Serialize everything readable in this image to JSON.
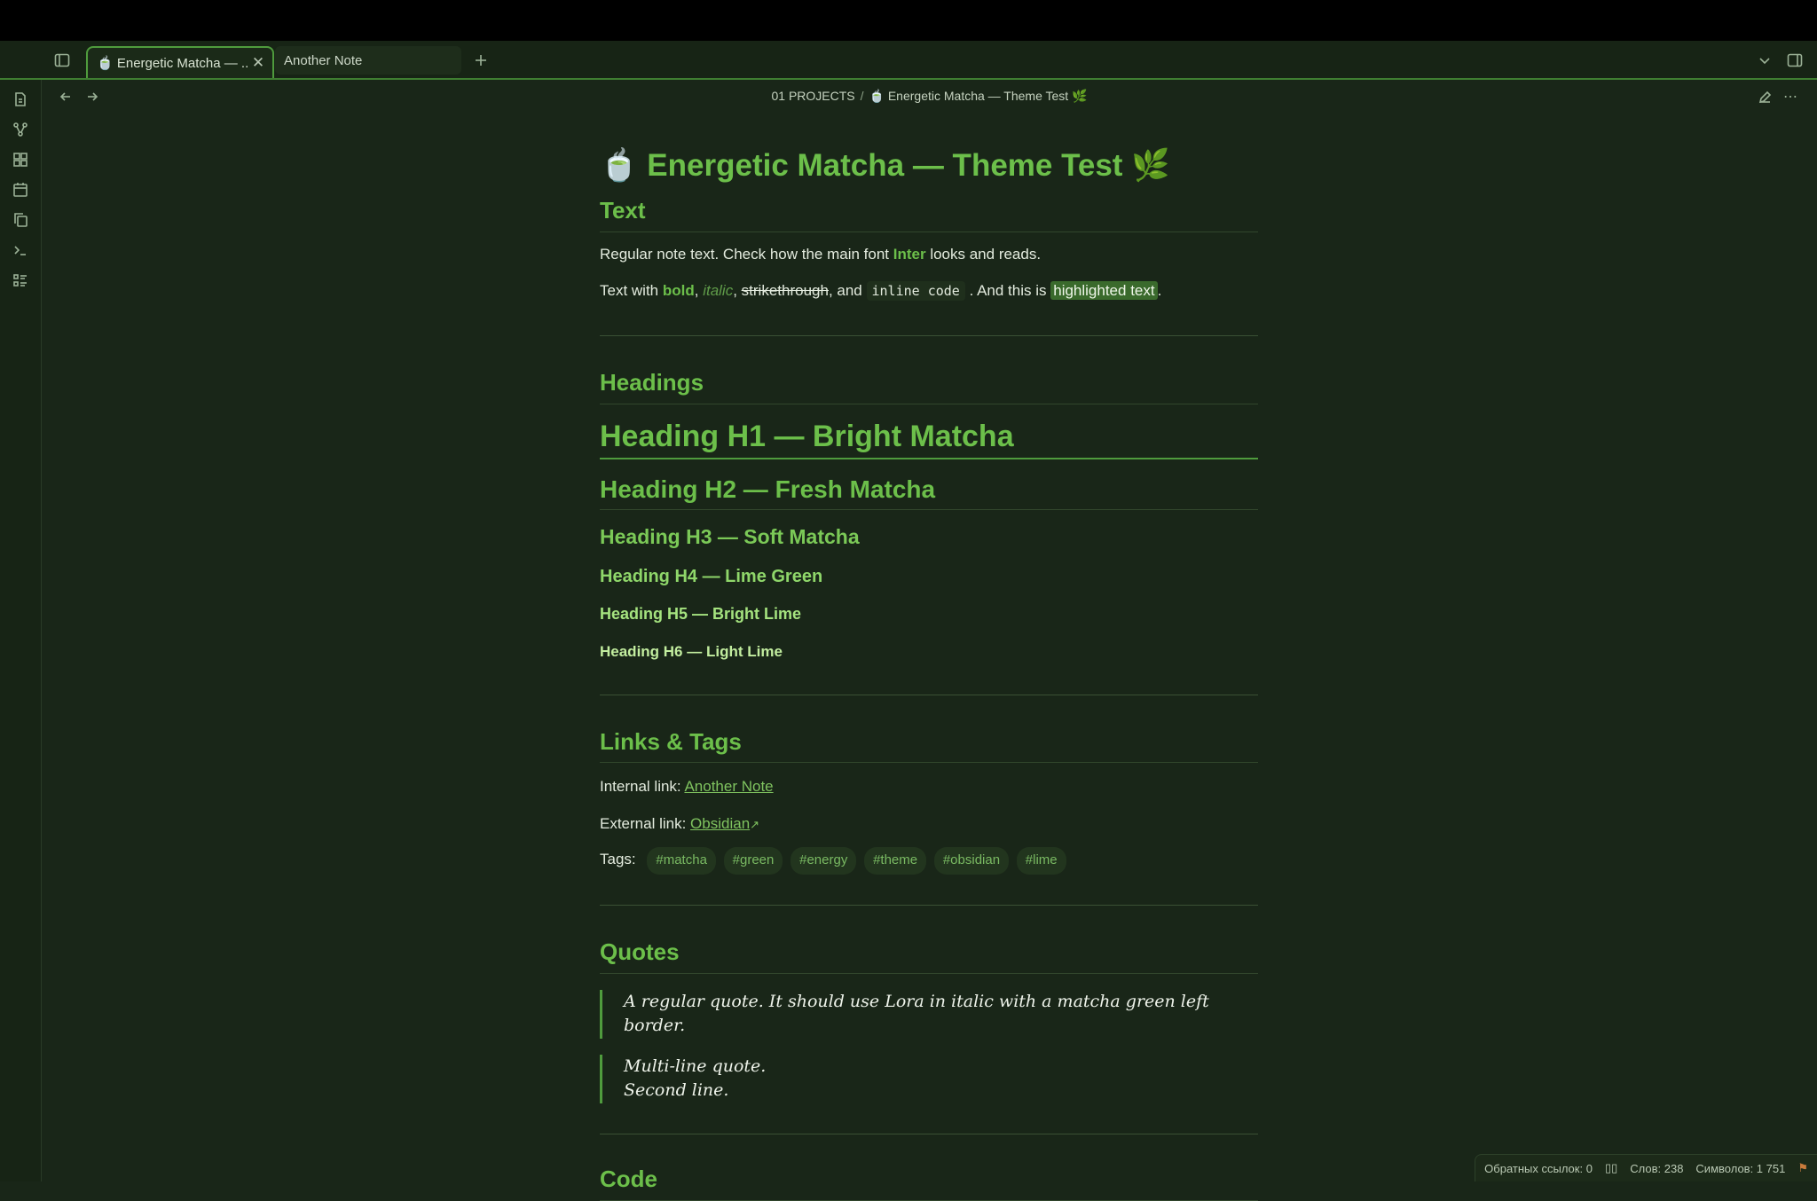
{
  "tabs": [
    {
      "title": "🍵 Energetic Matcha — ...",
      "active": true
    },
    {
      "title": "Another Note",
      "active": false
    }
  ],
  "ribbon": [
    "files-icon",
    "graph-icon",
    "canvas-icon",
    "calendar-icon",
    "pages-icon",
    "terminal-icon",
    "outline-icon"
  ],
  "breadcrumb": {
    "folder": "01 PROJECTS",
    "separator": "/",
    "note": "🍵 Energetic Matcha — Theme Test 🌿"
  },
  "note": {
    "title": "🍵 Energetic Matcha — Theme Test 🌿",
    "text_section": {
      "heading": "Text",
      "p1": {
        "before": "Regular note text. Check how the main font ",
        "font": "Inter",
        "after": " looks and reads."
      },
      "p2": {
        "before": "Text with ",
        "bold": "bold",
        "c1": ", ",
        "italic": "italic",
        "c2": ", ",
        "strike": "strikethrough",
        "c3": ", and ",
        "code": "inline code",
        "c4": " . And this is ",
        "highlight": "highlighted text",
        "end": "."
      }
    },
    "headings_section": {
      "heading": "Headings",
      "h1": "Heading H1 — Bright Matcha",
      "h2": "Heading H2 — Fresh Matcha",
      "h3": "Heading H3 — Soft Matcha",
      "h4": "Heading H4 — Lime Green",
      "h5": "Heading H5 — Bright Lime",
      "h6": "Heading H6 — Light Lime"
    },
    "links_section": {
      "heading": "Links & Tags",
      "internal_label": "Internal link: ",
      "internal_link": "Another Note",
      "external_label": "External link: ",
      "external_link": "Obsidian",
      "tags_label": "Tags:",
      "tags": [
        "#matcha",
        "#green",
        "#energy",
        "#theme",
        "#obsidian",
        "#lime"
      ]
    },
    "quotes_section": {
      "heading": "Quotes",
      "quote1": "A regular quote. It should use Lora in italic with a matcha green left border.",
      "quote2_line1": "Multi-line quote.",
      "quote2_line2": "Second line."
    },
    "code_section": {
      "heading": "Code"
    }
  },
  "status": {
    "backlinks": "Обратных ссылок: 0",
    "words": "Слов: 238",
    "chars": "Символов: 1 751"
  },
  "colors": {
    "accent": "#6cbf4a",
    "background": "#192618",
    "border": "#4f9b3d"
  }
}
